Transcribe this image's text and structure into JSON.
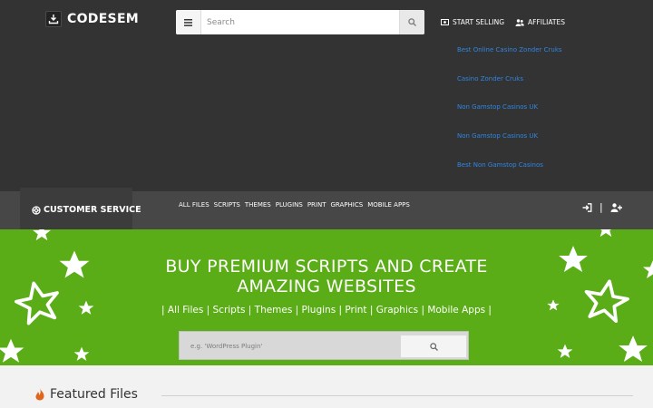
{
  "header": {
    "logo_text": "CODESEM",
    "logo_icon": "download-icon",
    "search_placeholder": "Search",
    "links": [
      {
        "label": "START SELLING",
        "icon": "money-icon"
      },
      {
        "label": "AFFILIATES",
        "icon": "users-icon"
      }
    ]
  },
  "promo_links": [
    "Best Online Casino Zonder Cruks",
    "Casino Zonder Cruks",
    "Non Gamstop Casinos UK",
    "Non Gamstop Casinos UK",
    "Best Non Gamstop Casinos"
  ],
  "nav": {
    "customer_service": "CUSTOMER SERVICE",
    "categories": [
      "ALL FILES",
      "SCRIPTS",
      "THEMES",
      "PLUGINS",
      "PRINT",
      "GRAPHICS",
      "MOBILE APPS"
    ],
    "auth_separator": "|"
  },
  "hero": {
    "title_line1": "BUY PREMIUM SCRIPTS AND CREATE",
    "title_line2": "AMAZING WEBSITES",
    "links_text": "| All Files | Scripts | Themes | Plugins | Print | Graphics | Mobile Apps |",
    "search_placeholder": "e.g. 'WordPress Plugin'"
  },
  "featured": {
    "title": "Featured Files"
  },
  "colors": {
    "header_bg": "#333333",
    "nav_bg": "#474747",
    "hero_green": "#5aad17",
    "link_blue": "#2f86e3"
  }
}
